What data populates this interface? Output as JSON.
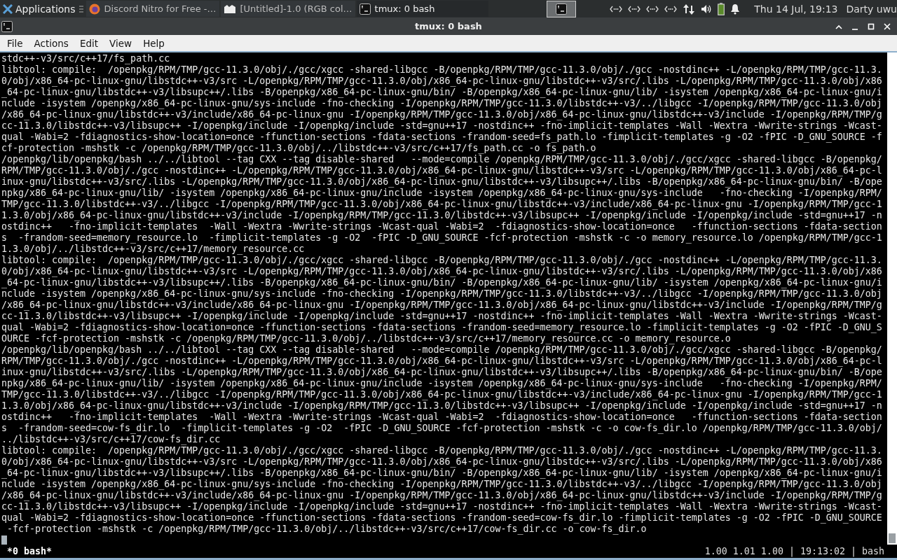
{
  "panel": {
    "apps_menu": "Applications",
    "tasks": [
      {
        "title": "Discord Nitro for Free -…",
        "kind": "browser",
        "selected": false
      },
      {
        "title": "[Untitled]-1.0 (RGB col…",
        "kind": "paint",
        "selected": false
      },
      {
        "title": "tmux: 0 bash",
        "kind": "terminal",
        "selected": true
      }
    ],
    "clock": "Thu 14 Jul, 19:13",
    "user": "Darty uwu"
  },
  "window": {
    "title": "tmux: 0 bash"
  },
  "menu": [
    "File",
    "Actions",
    "Edit",
    "View",
    "Help"
  ],
  "terminal": {
    "lines": [
      "stdc++-v3/src/c++17/fs_path.cc",
      "libtool: compile:  /openpkg/RPM/TMP/gcc-11.3.0/obj/./gcc/xgcc -shared-libgcc -B/openpkg/RPM/TMP/gcc-11.3.0/obj/./gcc -nostdinc++ -L/openpkg/RPM/TMP/gcc-11.3.",
      "0/obj/x86_64-pc-linux-gnu/libstdc++-v3/src -L/openpkg/RPM/TMP/gcc-11.3.0/obj/x86_64-pc-linux-gnu/libstdc++-v3/src/.libs -L/openpkg/RPM/TMP/gcc-11.3.0/obj/x86",
      "_64-pc-linux-gnu/libstdc++-v3/libsupc++/.libs -B/openpkg/x86_64-pc-linux-gnu/bin/ -B/openpkg/x86_64-pc-linux-gnu/lib/ -isystem /openpkg/x86_64-pc-linux-gnu/i",
      "nclude -isystem /openpkg/x86_64-pc-linux-gnu/sys-include -fno-checking -I/openpkg/RPM/TMP/gcc-11.3.0/libstdc++-v3/../libgcc -I/openpkg/RPM/TMP/gcc-11.3.0/obj",
      "/x86_64-pc-linux-gnu/libstdc++-v3/include/x86_64-pc-linux-gnu -I/openpkg/RPM/TMP/gcc-11.3.0/obj/x86_64-pc-linux-gnu/libstdc++-v3/include -I/openpkg/RPM/TMP/g",
      "cc-11.3.0/libstdc++-v3/libsupc++ -I/openpkg/include -I/openpkg/include -std=gnu++17 -nostdinc++ -fno-implicit-templates -Wall -Wextra -Wwrite-strings -Wcast-",
      "qual -Wabi=2 -fdiagnostics-show-location=once -ffunction-sections -fdata-sections -frandom-seed=fs_path.lo -fimplicit-templates -g -O2 -fPIC -D_GNU_SOURCE -f",
      "cf-protection -mshstk -c /openpkg/RPM/TMP/gcc-11.3.0/obj/../libstdc++-v3/src/c++17/fs_path.cc -o fs_path.o",
      "/openpkg/lib/openpkg/bash ../../libtool --tag CXX --tag disable-shared   --mode=compile /openpkg/RPM/TMP/gcc-11.3.0/obj/./gcc/xgcc -shared-libgcc -B/openpkg/",
      "RPM/TMP/gcc-11.3.0/obj/./gcc -nostdinc++ -L/openpkg/RPM/TMP/gcc-11.3.0/obj/x86_64-pc-linux-gnu/libstdc++-v3/src -L/openpkg/RPM/TMP/gcc-11.3.0/obj/x86_64-pc-l",
      "inux-gnu/libstdc++-v3/src/.libs -L/openpkg/RPM/TMP/gcc-11.3.0/obj/x86_64-pc-linux-gnu/libstdc++-v3/libsupc++/.libs -B/openpkg/x86_64-pc-linux-gnu/bin/ -B/ope",
      "npkg/x86_64-pc-linux-gnu/lib/ -isystem /openpkg/x86_64-pc-linux-gnu/include -isystem /openpkg/x86_64-pc-linux-gnu/sys-include   -fno-checking -I/openpkg/RPM/",
      "TMP/gcc-11.3.0/libstdc++-v3/../libgcc -I/openpkg/RPM/TMP/gcc-11.3.0/obj/x86_64-pc-linux-gnu/libstdc++-v3/include/x86_64-pc-linux-gnu -I/openpkg/RPM/TMP/gcc-1",
      "1.3.0/obj/x86_64-pc-linux-gnu/libstdc++-v3/include -I/openpkg/RPM/TMP/gcc-11.3.0/libstdc++-v3/libsupc++ -I/openpkg/include -I/openpkg/include -std=gnu++17 -n",
      "ostdinc++   -fno-implicit-templates  -Wall -Wextra -Wwrite-strings -Wcast-qual -Wabi=2  -fdiagnostics-show-location=once   -ffunction-sections -fdata-section",
      "s  -frandom-seed=memory_resource.lo  -fimplicit-templates -g -O2  -fPIC -D_GNU_SOURCE -fcf-protection -mshstk -c -o memory_resource.lo /openpkg/RPM/TMP/gcc-1",
      "1.3.0/obj/../libstdc++-v3/src/c++17/memory_resource.cc",
      "libtool: compile:  /openpkg/RPM/TMP/gcc-11.3.0/obj/./gcc/xgcc -shared-libgcc -B/openpkg/RPM/TMP/gcc-11.3.0/obj/./gcc -nostdinc++ -L/openpkg/RPM/TMP/gcc-11.3.",
      "0/obj/x86_64-pc-linux-gnu/libstdc++-v3/src -L/openpkg/RPM/TMP/gcc-11.3.0/obj/x86_64-pc-linux-gnu/libstdc++-v3/src/.libs -L/openpkg/RPM/TMP/gcc-11.3.0/obj/x86",
      "_64-pc-linux-gnu/libstdc++-v3/libsupc++/.libs -B/openpkg/x86_64-pc-linux-gnu/bin/ -B/openpkg/x86_64-pc-linux-gnu/lib/ -isystem /openpkg/x86_64-pc-linux-gnu/i",
      "nclude -isystem /openpkg/x86_64-pc-linux-gnu/sys-include -fno-checking -I/openpkg/RPM/TMP/gcc-11.3.0/libstdc++-v3/../libgcc -I/openpkg/RPM/TMP/gcc-11.3.0/obj",
      "/x86_64-pc-linux-gnu/libstdc++-v3/include/x86_64-pc-linux-gnu -I/openpkg/RPM/TMP/gcc-11.3.0/obj/x86_64-pc-linux-gnu/libstdc++-v3/include -I/openpkg/RPM/TMP/g",
      "cc-11.3.0/libstdc++-v3/libsupc++ -I/openpkg/include -I/openpkg/include -std=gnu++17 -nostdinc++ -fno-implicit-templates -Wall -Wextra -Wwrite-strings -Wcast-",
      "qual -Wabi=2 -fdiagnostics-show-location=once -ffunction-sections -fdata-sections -frandom-seed=memory_resource.lo -fimplicit-templates -g -O2 -fPIC -D_GNU_S",
      "OURCE -fcf-protection -mshstk -c /openpkg/RPM/TMP/gcc-11.3.0/obj/../libstdc++-v3/src/c++17/memory_resource.cc -o memory_resource.o",
      "/openpkg/lib/openpkg/bash ../../libtool --tag CXX --tag disable-shared   --mode=compile /openpkg/RPM/TMP/gcc-11.3.0/obj/./gcc/xgcc -shared-libgcc -B/openpkg/",
      "RPM/TMP/gcc-11.3.0/obj/./gcc -nostdinc++ -L/openpkg/RPM/TMP/gcc-11.3.0/obj/x86_64-pc-linux-gnu/libstdc++-v3/src -L/openpkg/RPM/TMP/gcc-11.3.0/obj/x86_64-pc-l",
      "inux-gnu/libstdc++-v3/src/.libs -L/openpkg/RPM/TMP/gcc-11.3.0/obj/x86_64-pc-linux-gnu/libstdc++-v3/libsupc++/.libs -B/openpkg/x86_64-pc-linux-gnu/bin/ -B/ope",
      "npkg/x86_64-pc-linux-gnu/lib/ -isystem /openpkg/x86_64-pc-linux-gnu/include -isystem /openpkg/x86_64-pc-linux-gnu/sys-include   -fno-checking -I/openpkg/RPM/",
      "TMP/gcc-11.3.0/libstdc++-v3/../libgcc -I/openpkg/RPM/TMP/gcc-11.3.0/obj/x86_64-pc-linux-gnu/libstdc++-v3/include/x86_64-pc-linux-gnu -I/openpkg/RPM/TMP/gcc-1",
      "1.3.0/obj/x86_64-pc-linux-gnu/libstdc++-v3/include -I/openpkg/RPM/TMP/gcc-11.3.0/libstdc++-v3/libsupc++ -I/openpkg/include -I/openpkg/include -std=gnu++17 -n",
      "ostdinc++   -fno-implicit-templates  -Wall -Wextra -Wwrite-strings -Wcast-qual -Wabi=2  -fdiagnostics-show-location=once   -ffunction-sections -fdata-section",
      "s  -frandom-seed=cow-fs_dir.lo  -fimplicit-templates -g -O2  -fPIC -D_GNU_SOURCE -fcf-protection -mshstk -c -o cow-fs_dir.lo /openpkg/RPM/TMP/gcc-11.3.0/obj/",
      "../libstdc++-v3/src/c++17/cow-fs_dir.cc",
      "libtool: compile:  /openpkg/RPM/TMP/gcc-11.3.0/obj/./gcc/xgcc -shared-libgcc -B/openpkg/RPM/TMP/gcc-11.3.0/obj/./gcc -nostdinc++ -L/openpkg/RPM/TMP/gcc-11.3.",
      "0/obj/x86_64-pc-linux-gnu/libstdc++-v3/src -L/openpkg/RPM/TMP/gcc-11.3.0/obj/x86_64-pc-linux-gnu/libstdc++-v3/src/.libs -L/openpkg/RPM/TMP/gcc-11.3.0/obj/x86",
      "_64-pc-linux-gnu/libstdc++-v3/libsupc++/.libs -B/openpkg/x86_64-pc-linux-gnu/bin/ -B/openpkg/x86_64-pc-linux-gnu/lib/ -isystem /openpkg/x86_64-pc-linux-gnu/i",
      "nclude -isystem /openpkg/x86_64-pc-linux-gnu/sys-include -fno-checking -I/openpkg/RPM/TMP/gcc-11.3.0/libstdc++-v3/../libgcc -I/openpkg/RPM/TMP/gcc-11.3.0/obj",
      "/x86_64-pc-linux-gnu/libstdc++-v3/include/x86_64-pc-linux-gnu -I/openpkg/RPM/TMP/gcc-11.3.0/obj/x86_64-pc-linux-gnu/libstdc++-v3/include -I/openpkg/RPM/TMP/g",
      "cc-11.3.0/libstdc++-v3/libsupc++ -I/openpkg/include -I/openpkg/include -std=gnu++17 -nostdinc++ -fno-implicit-templates -Wall -Wextra -Wwrite-strings -Wcast-",
      "qual -Wabi=2 -fdiagnostics-show-location=once -ffunction-sections -fdata-sections -frandom-seed=cow-fs_dir.lo -fimplicit-templates -g -O2 -fPIC -D_GNU_SOURCE",
      " -fcf-protection -mshstk -c /openpkg/RPM/TMP/gcc-11.3.0/obj/../libstdc++-v3/src/c++17/cow-fs_dir.cc -o cow-fs_dir.o"
    ]
  },
  "tmux_status": {
    "window": "*0 bash*",
    "info": "1.00 1.01 1.00 | 19:13:02 | bash"
  }
}
